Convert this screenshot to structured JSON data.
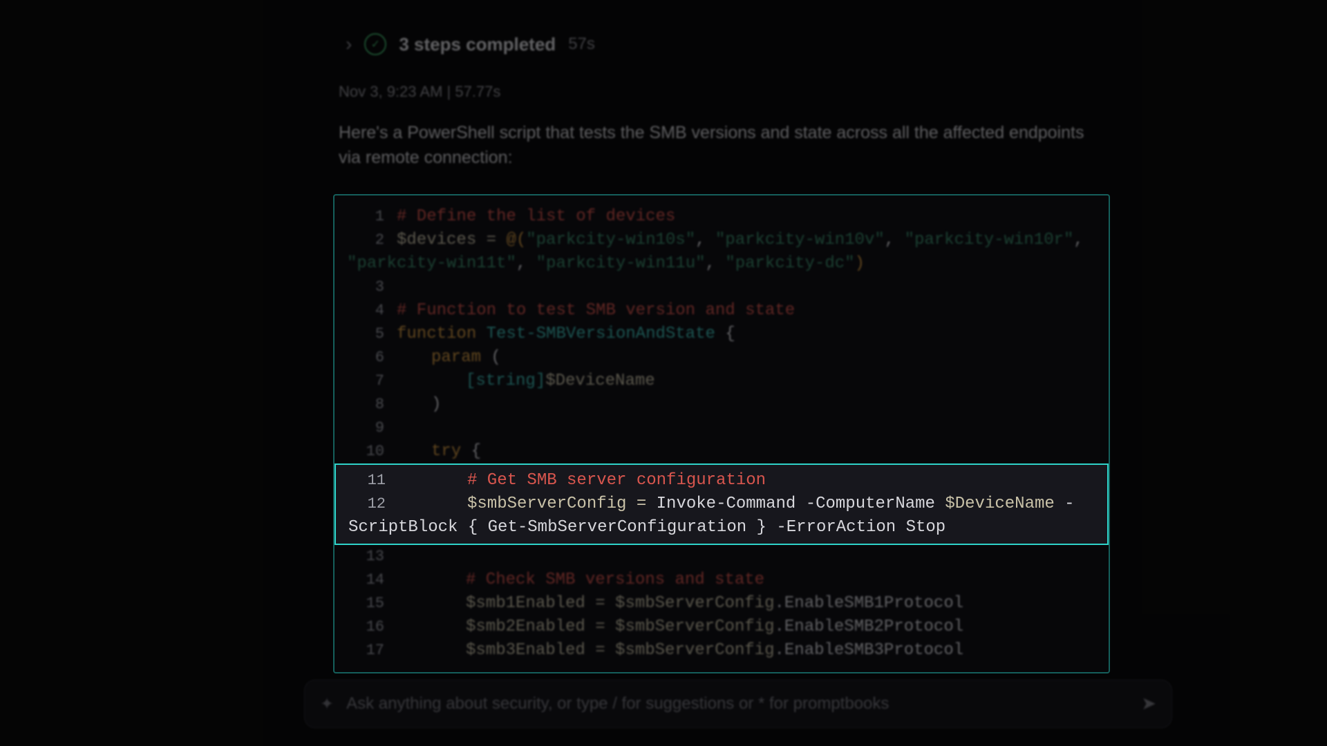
{
  "header": {
    "steps_label": "3 steps completed",
    "elapsed": "57s"
  },
  "meta": {
    "timestamp": "Nov 3, 9:23 AM | 57.77s"
  },
  "body": {
    "text": "Here's a PowerShell script that tests the SMB versions and state across all the affected endpoints via remote connection:"
  },
  "code": {
    "lines": {
      "l1": {
        "n": "1",
        "comment": "# Define the list of devices"
      },
      "l2": {
        "n": "2",
        "var": "$devices",
        "eq": " = ",
        "at": "@(",
        "s1": "\"parkcity-win10s\"",
        "c1": ", ",
        "s2": "\"parkcity-win10v\"",
        "c2": ", ",
        "s3": "\"parkcity-win10r\"",
        "c3": ","
      },
      "l2b": {
        "s4": "\"parkcity-win11t\"",
        "c4": ", ",
        "s5": "\"parkcity-win11u\"",
        "c5": ", ",
        "s6": "\"parkcity-dc\"",
        "close": ")"
      },
      "l3": {
        "n": "3"
      },
      "l4": {
        "n": "4",
        "comment": "# Function to test SMB version and state"
      },
      "l5": {
        "n": "5",
        "kw": "function",
        "sp": " ",
        "name": "Test-SMBVersionAndState",
        "brace": " {"
      },
      "l6": {
        "n": "6",
        "kw": "param",
        "paren": " ("
      },
      "l7": {
        "n": "7",
        "type": "[string]",
        "var": "$DeviceName"
      },
      "l8": {
        "n": "8",
        "paren": ")"
      },
      "l9": {
        "n": "9"
      },
      "l10": {
        "n": "10",
        "kw": "try",
        "brace": " {"
      },
      "l11": {
        "n": "11",
        "comment": "# Get SMB server configuration"
      },
      "l12": {
        "n": "12",
        "var": "$smbServerConfig",
        "eq": " = ",
        "cmd": "Invoke-Command",
        "arg1": " -ComputerName ",
        "dv": "$DeviceName",
        "dash": " -"
      },
      "l12b": {
        "sb": "ScriptBlock",
        "open": " { ",
        "inner": "Get-SmbServerConfiguration",
        "close": " } ",
        "ea": "-ErrorAction",
        "sp": " ",
        "stop": "Stop"
      },
      "l13": {
        "n": "13"
      },
      "l14": {
        "n": "14",
        "comment": "# Check SMB versions and state"
      },
      "l15": {
        "n": "15",
        "var": "$smb1Enabled",
        "eq": " = ",
        "rhsv": "$smbServerConfig",
        "dot": ".EnableSMB1Protocol"
      },
      "l16": {
        "n": "16",
        "var": "$smb2Enabled",
        "eq": " = ",
        "rhsv": "$smbServerConfig",
        "dot": ".EnableSMB2Protocol"
      },
      "l17": {
        "n": "17",
        "var": "$smb3Enabled",
        "eq": " = ",
        "rhsv": "$smbServerConfig",
        "dot": ".EnableSMB3Protocol"
      }
    }
  },
  "input": {
    "placeholder": "Ask anything about security, or type / for suggestions or * for promptbooks"
  },
  "icons": {
    "chevron": "›",
    "check": "✓",
    "spark": "✦",
    "send": "➤"
  }
}
